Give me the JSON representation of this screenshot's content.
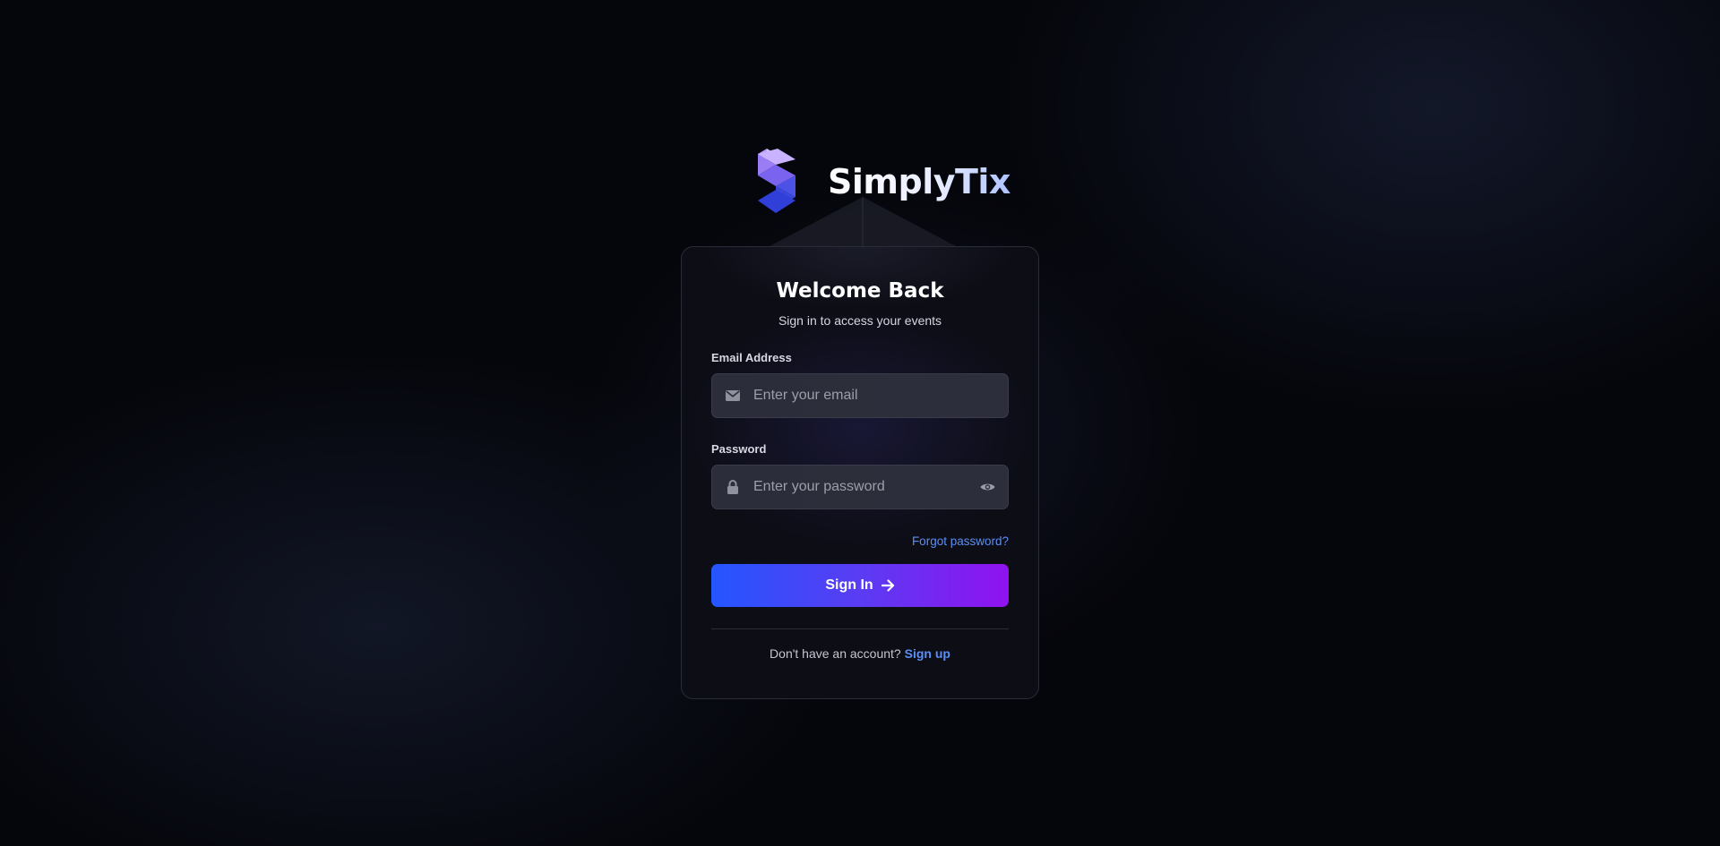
{
  "brand": {
    "name": "SimplyTix",
    "logo_icon": "simplytix-logo-icon"
  },
  "card": {
    "title": "Welcome Back",
    "subtitle": "Sign in to access your events",
    "email": {
      "label": "Email Address",
      "placeholder": "Enter your email",
      "value": "",
      "icon": "envelope-icon"
    },
    "password": {
      "label": "Password",
      "placeholder": "Enter your password",
      "value": "",
      "icon": "lock-icon",
      "toggle_icon": "eye-icon"
    },
    "forgot_link": "Forgot password?",
    "signin_button": "Sign In",
    "signin_icon": "arrow-right-icon",
    "footer": {
      "prompt": "Don't have an account?",
      "signup_link": "Sign up"
    }
  },
  "colors": {
    "accent_link": "#5b8ff5",
    "button_gradient_start": "#2456ff",
    "button_gradient_end": "#9012f0",
    "logo_light": "#c4a6ff",
    "logo_dark": "#2f3fd8"
  }
}
